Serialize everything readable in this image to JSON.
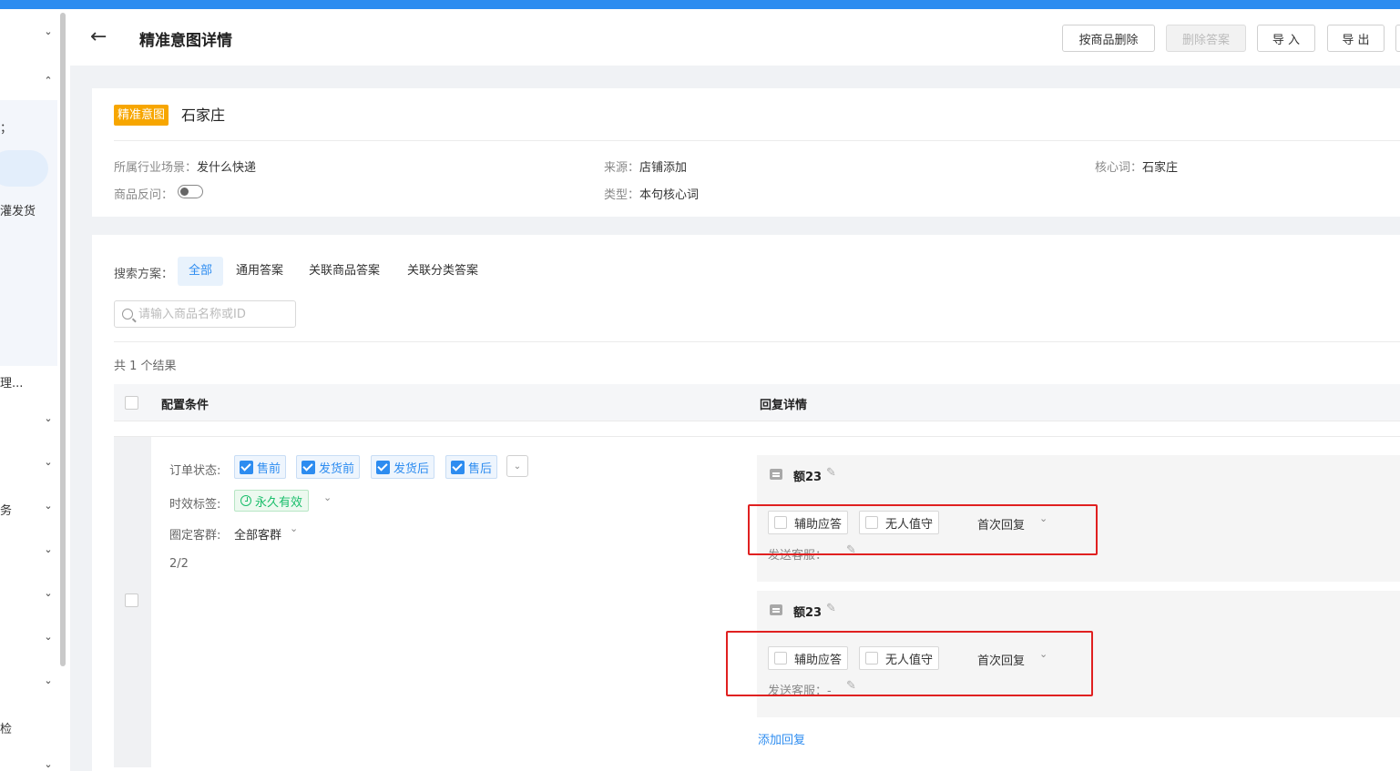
{
  "sidebar": {
    "fragments": [
      "；",
      "灌发货",
      "理...",
      "务",
      "检"
    ]
  },
  "header": {
    "back_label": "←",
    "title": "精准意图详情",
    "buttons": {
      "delete_by_product": "按商品删除",
      "delete_answer": "删除答案",
      "import": "导 入",
      "export": "导 出"
    }
  },
  "intent": {
    "tag": "精准意图",
    "name": "石家庄",
    "industry_label": "所属行业场景：",
    "industry_value": "发什么快递",
    "source_label": "来源：",
    "source_value": "店铺添加",
    "core_word_label": "核心词：",
    "core_word_value": "石家庄",
    "product_reverse_label": "商品反问：",
    "product_reverse_on": false,
    "type_label": "类型：",
    "type_value": "本句核心词"
  },
  "filter": {
    "label": "搜索方案：",
    "tabs": [
      "全部",
      "通用答案",
      "关联商品答案",
      "关联分类答案"
    ],
    "active_tab": "全部",
    "search_placeholder": "请输入商品名称或ID",
    "result_count": "共 1 个结果"
  },
  "table": {
    "headers": {
      "conditions": "配置条件",
      "reply_detail": "回复详情"
    }
  },
  "row": {
    "order_status_label": "订单状态:",
    "order_status_options": [
      "售前",
      "发货前",
      "发货后",
      "售后"
    ],
    "time_tag_label": "时效标签:",
    "time_tag_value": "永久有效",
    "customer_group_label": "圈定客群:",
    "customer_group_value": "全部客群",
    "page_fraction": "2/2",
    "replies": [
      {
        "title": "额23",
        "assist_label": "辅助应答",
        "unattended_label": "无人值守",
        "first_reply_label": "首次回复",
        "send_cs_label": "发送客服："
      },
      {
        "title": "额23",
        "assist_label": "辅助应答",
        "unattended_label": "无人值守",
        "first_reply_label": "首次回复",
        "send_cs_label": "发送客服：-"
      }
    ],
    "add_reply": "添加回复"
  },
  "colors": {
    "primary": "#2d8cf0",
    "intent_tag": "#f7a600",
    "success": "#19be6b",
    "annotation": "#e02020"
  }
}
